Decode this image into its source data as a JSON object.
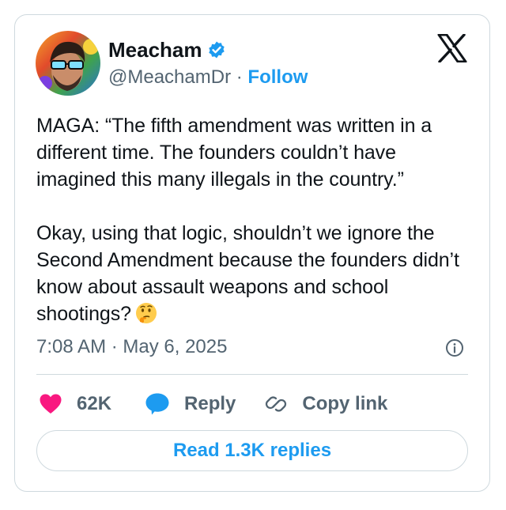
{
  "author": {
    "display_name": "Meacham",
    "handle": "@MeachamDr",
    "separator": "·",
    "follow_label": "Follow",
    "verified": true
  },
  "tweet": {
    "paragraph_1": "MAGA: “The fifth amendment was written in a different time. The founders couldn’t have imagined this many illegals in the country.”",
    "paragraph_2": "Okay, using that logic, shouldn’t we ignore the Second Amendment because the founders didn’t know about assault weapons and school shootings?",
    "emoji": "thinking-face",
    "timestamp": "7:08 AM · May 6, 2025"
  },
  "actions": {
    "like_count": "62K",
    "reply_label": "Reply",
    "copy_link_label": "Copy link"
  },
  "read_replies_label": "Read 1.3K replies",
  "colors": {
    "accent": "#1d9bf0",
    "like": "#f91880",
    "text": "#0f1419",
    "muted": "#536471",
    "border": "#cfd9de"
  },
  "icons": [
    "x-logo-icon",
    "verified-badge-icon",
    "info-icon",
    "heart-icon",
    "reply-bubble-icon",
    "link-icon",
    "thinking-face-emoji"
  ]
}
